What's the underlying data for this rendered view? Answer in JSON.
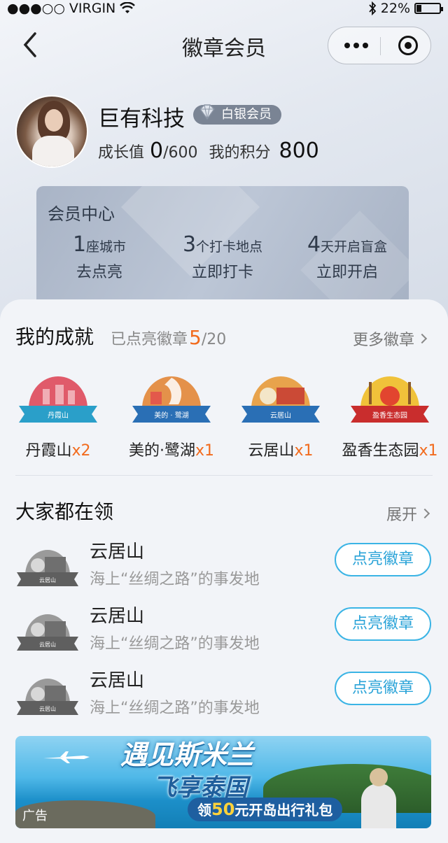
{
  "status_bar": {
    "carrier": "●●●○○ VIRGIN",
    "battery": "22%",
    "battery_level": 0.22
  },
  "nav": {
    "title": "徽章会员"
  },
  "profile": {
    "name": "巨有科技",
    "level": "白银会员",
    "growth_label": "成长值",
    "growth_value": "0",
    "growth_max": "/600",
    "points_label": "我的积分",
    "points_value": "800"
  },
  "member_center": {
    "title": "会员中心",
    "items": [
      {
        "num": "1",
        "unit": "座城市",
        "action": "去点亮"
      },
      {
        "num": "3",
        "unit": "个打卡地点",
        "action": "立即打卡"
      },
      {
        "num": "4",
        "unit": "天开启盲盒",
        "action": "立即开启"
      }
    ]
  },
  "achievements": {
    "title": "我的成就",
    "lit_label": "已点亮徽章",
    "lit_count": "5",
    "lit_total": "/20",
    "more": "更多徽章",
    "badges": [
      {
        "name": "丹霞山",
        "count": "x2",
        "ribbon": "丹霞山",
        "color": "#e05a6a",
        "ribbon_color": "#2a9fc9"
      },
      {
        "name": "美的·鹭湖",
        "count": "x1",
        "ribbon": "美的 · 鹭湖",
        "color": "#e4914a",
        "ribbon_color": "#2a6fb5"
      },
      {
        "name": "云居山",
        "count": "x1",
        "ribbon": "云居山",
        "color": "#e8a34c",
        "ribbon_color": "#2a6fb5"
      },
      {
        "name": "盈香生态园",
        "count": "x1",
        "ribbon": "盈香生态园",
        "color": "#f0c23a",
        "ribbon_color": "#c92d2d"
      }
    ]
  },
  "popular": {
    "title": "大家都在领",
    "more": "展开",
    "items": [
      {
        "name": "云居山",
        "desc": "海上“丝绸之路”的事发地",
        "button": "点亮徽章",
        "ribbon": "云居山"
      },
      {
        "name": "云居山",
        "desc": "海上“丝绸之路”的事发地",
        "button": "点亮徽章",
        "ribbon": "云居山"
      },
      {
        "name": "云居山",
        "desc": "海上“丝绸之路”的事发地",
        "button": "点亮徽章",
        "ribbon": "云居山"
      }
    ]
  },
  "ad": {
    "headline": "遇见斯米兰",
    "subline": "飞享泰国",
    "pill_prefix": "领",
    "pill_amount": "50",
    "pill_suffix": "元开岛出行礼包",
    "tag": "广告"
  }
}
